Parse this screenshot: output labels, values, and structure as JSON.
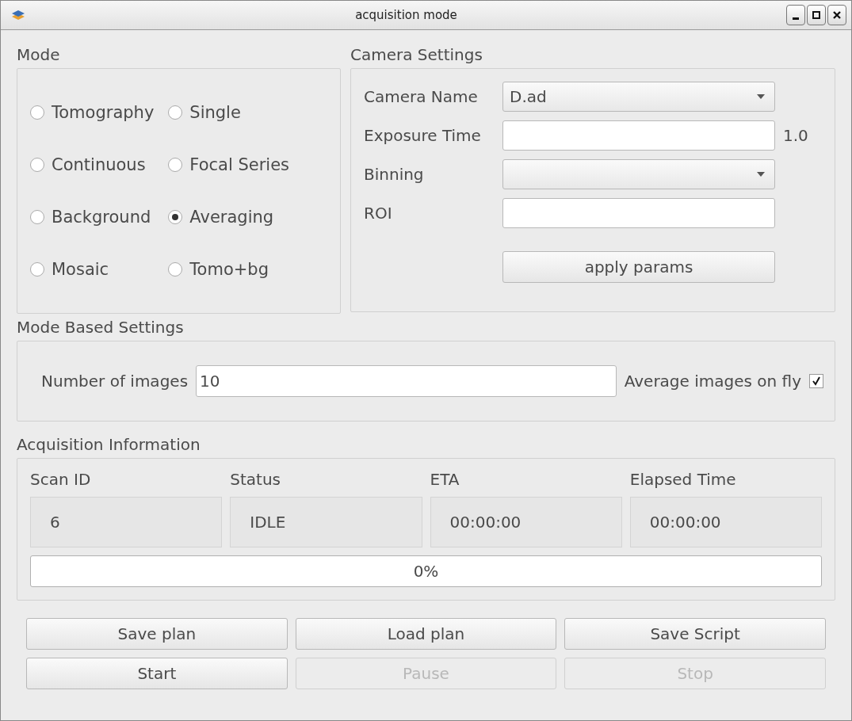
{
  "window": {
    "title": "acquisition mode"
  },
  "mode": {
    "title": "Mode",
    "options": [
      {
        "label": "Tomography",
        "selected": false
      },
      {
        "label": "Single",
        "selected": false
      },
      {
        "label": "Continuous",
        "selected": false
      },
      {
        "label": "Focal Series",
        "selected": false
      },
      {
        "label": "Background",
        "selected": false
      },
      {
        "label": "Averaging",
        "selected": true
      },
      {
        "label": "Mosaic",
        "selected": false
      },
      {
        "label": "Tomo+bg",
        "selected": false
      }
    ]
  },
  "camera_settings": {
    "title": "Camera Settings",
    "fields": [
      {
        "kind": "dropdown",
        "label": "Camera Name",
        "value": "D.ad"
      },
      {
        "kind": "text",
        "label": "Exposure Time",
        "suffix": "1.0"
      },
      {
        "kind": "dropdown",
        "label": "Binning"
      },
      {
        "kind": "text",
        "label": "ROI"
      }
    ],
    "apply_button": "apply params"
  },
  "mode_based_settings": {
    "title": "Mode Based Settings",
    "number_label": "Number of images",
    "number_value": "10",
    "average_label": "Average images on fly",
    "average_checked": true
  },
  "acquisition_information": {
    "title": "Acquisition Information",
    "items": [
      {
        "label": "Scan ID",
        "value": "6"
      },
      {
        "label": "Status",
        "value": "IDLE"
      },
      {
        "label": "ETA",
        "value": "00:00:00"
      },
      {
        "label": "Elapsed Time",
        "value": "00:00:00"
      }
    ],
    "progress": {
      "level": 0,
      "text": "0%"
    }
  },
  "buttons": [
    {
      "label": "Save plan",
      "disabled": false
    },
    {
      "label": "Load plan",
      "disabled": false
    },
    {
      "label": "Save Script",
      "disabled": false
    },
    {
      "label": "Start",
      "disabled": false
    },
    {
      "label": "Pause",
      "disabled": true
    },
    {
      "label": "Stop",
      "disabled": true
    }
  ]
}
